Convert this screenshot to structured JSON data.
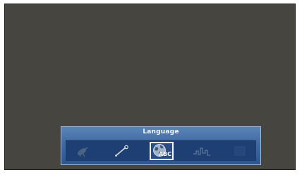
{
  "menu": {
    "title": "Language",
    "items": [
      {
        "name": "satellite-icon",
        "selected": false
      },
      {
        "name": "wrench-icon",
        "selected": false
      },
      {
        "name": "globe-language-icon",
        "label": "ABC",
        "selected": true
      },
      {
        "name": "signal-icon",
        "selected": false
      },
      {
        "name": "blank-icon",
        "selected": false
      }
    ]
  }
}
